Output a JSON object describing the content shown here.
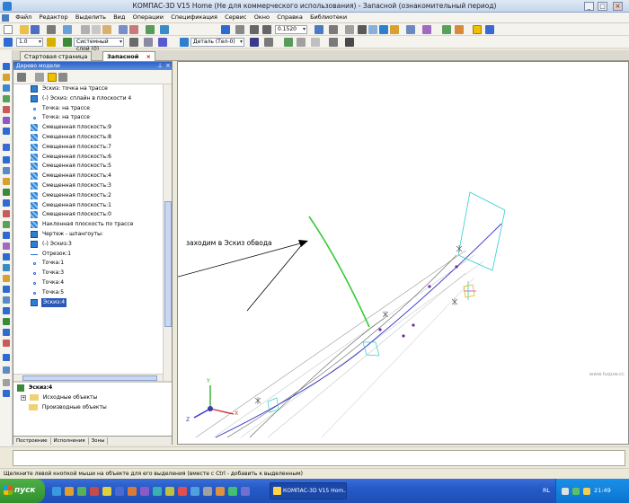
{
  "window": {
    "title": "КОМПАС-3D V15 Home (Не для коммерческого использования) - Запасной (ознакомительный период)",
    "minimize": "_",
    "restore": "□",
    "close": "×"
  },
  "menu": [
    "Файл",
    "Редактор",
    "Выделить",
    "Вид",
    "Операции",
    "Спецификация",
    "Сервис",
    "Окно",
    "Справка",
    "Библиотеки"
  ],
  "toolbar": {
    "scale_value": "0.1520",
    "line_width": "1.0",
    "layer": "Системный слой (0)",
    "part": "Деталь (Тел-0)"
  },
  "tabs": [
    {
      "label": "Стартовая страница"
    },
    {
      "label": "Запасной"
    }
  ],
  "tree": {
    "title": "Дерево модели",
    "items": [
      {
        "label": "Эскиз: точка на трасce",
        "icon": "sketch-icon"
      },
      {
        "label": "(-) Эскиз: сплайн в плоскости 4",
        "icon": "sketch-icon"
      },
      {
        "label": "Точка: на трасce",
        "icon": "point-icon"
      },
      {
        "label": "Точка: на трасce",
        "icon": "point-icon"
      },
      {
        "label": "Смещенная плоскость:9",
        "icon": "plane-icon"
      },
      {
        "label": "Смещенная плоскость:8",
        "icon": "plane-icon"
      },
      {
        "label": "Смещенная плоскость:7",
        "icon": "plane-icon"
      },
      {
        "label": "Смещенная плоскость:6",
        "icon": "plane-icon"
      },
      {
        "label": "Смещенная плоскость:5",
        "icon": "plane-icon"
      },
      {
        "label": "Смещенная плоскость:4",
        "icon": "plane-icon"
      },
      {
        "label": "Смещенная плоскость:3",
        "icon": "plane-icon"
      },
      {
        "label": "Смещенная плоскость:2",
        "icon": "plane-icon"
      },
      {
        "label": "Смещенная плоскость:1",
        "icon": "plane-icon"
      },
      {
        "label": "Смещенная плоскость:0",
        "icon": "plane-icon"
      },
      {
        "label": "Наклонная плоскость по трасce",
        "icon": "plane-icon"
      },
      {
        "label": "Чертеж - шпангоуты:",
        "icon": "sketch-icon"
      },
      {
        "label": "(-) Эскиз:3",
        "icon": "sketch-icon"
      },
      {
        "label": "Отрезок:1",
        "icon": "segment-icon"
      },
      {
        "label": "Точка:1",
        "icon": "point-icon"
      },
      {
        "label": "Точка:3",
        "icon": "point-icon"
      },
      {
        "label": "Точка:4",
        "icon": "point-icon"
      },
      {
        "label": "Точка:5",
        "icon": "point-icon"
      },
      {
        "label": "Эскиз:4",
        "icon": "sketch-icon",
        "selected": true
      }
    ],
    "sub_title": "Эскиз:4",
    "sub_items": [
      "Исходные объекты",
      "Производные объекты"
    ],
    "bottom_tabs": [
      "Построение",
      "Исполнения",
      "Зоны"
    ]
  },
  "canvas": {
    "annotation": "заходим в Эскиз обвода",
    "axis_x": "X",
    "axis_y": "Y",
    "axis_z": "Z",
    "watermark": "www.tuquw.cc"
  },
  "status": {
    "hint": "Щелкните левой кнопкой мыши на объекте для его выделения (вместе с Ctrl - добавить к выделенным)"
  },
  "taskbar": {
    "start": "пуск",
    "task": "КОМПАС-3D V15 Hom...",
    "lang": "RL",
    "time": "21:49"
  },
  "colors": {
    "selection": "#2a5ab8",
    "spline": "#33cc33",
    "guide": "#3333cc",
    "plane": "#33cccc"
  }
}
